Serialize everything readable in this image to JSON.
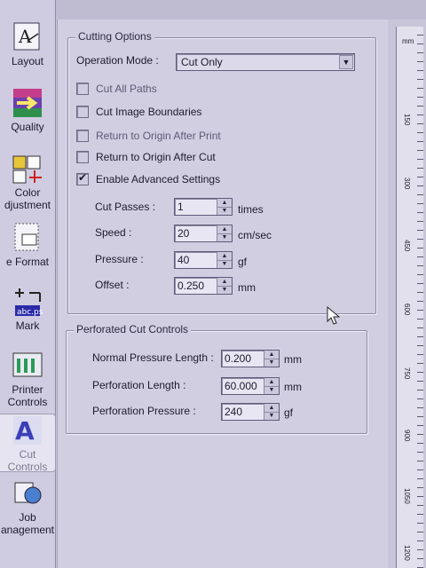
{
  "sidebar": {
    "items": [
      {
        "label": "Layout",
        "icon": "layout-icon"
      },
      {
        "label": "Quality",
        "icon": "quality-icon"
      },
      {
        "label": "Color Adjustment",
        "line1": "Color",
        "line2": "djustment",
        "icon": "color-adjustment-icon"
      },
      {
        "label": "e Format",
        "icon": "page-format-icon"
      },
      {
        "label": "Mark",
        "icon": "mark-icon"
      },
      {
        "label": "Printer Controls",
        "line1": "Printer",
        "line2": "Controls",
        "icon": "printer-controls-icon"
      },
      {
        "label": "Cut Controls",
        "line1": "Cut",
        "line2": "Controls",
        "icon": "cut-controls-icon",
        "selected": true
      },
      {
        "label": "Job Management",
        "line1": "Job",
        "line2": "anagement",
        "icon": "job-management-icon"
      }
    ],
    "icon_label": {
      "abc": "abc.ps",
      "ps": "ps"
    }
  },
  "cutting_options": {
    "title": "Cutting Options",
    "operation_mode_label": "Operation Mode :",
    "operation_mode_value": "Cut Only",
    "checkboxes": [
      {
        "label": "Cut All Paths",
        "checked": false
      },
      {
        "label": "Cut Image Boundaries",
        "checked": false
      },
      {
        "label": "Return to Origin After Print",
        "checked": false
      },
      {
        "label": "Return to Origin After Cut",
        "checked": false
      },
      {
        "label": "Enable Advanced Settings",
        "checked": true
      }
    ],
    "fields": [
      {
        "label": "Cut Passes :",
        "value": "1",
        "unit": "times"
      },
      {
        "label": "Speed :",
        "value": "20",
        "unit": "cm/sec"
      },
      {
        "label": "Pressure :",
        "value": "40",
        "unit": "gf"
      },
      {
        "label": "Offset :",
        "value": "0.250",
        "unit": "mm"
      }
    ]
  },
  "perforated": {
    "title": "Perforated Cut Controls",
    "fields": [
      {
        "label": "Normal Pressure Length :",
        "value": "0.200",
        "unit": "mm"
      },
      {
        "label": "Perforation Length :",
        "value": "60.000",
        "unit": "mm"
      },
      {
        "label": "Perforation Pressure :",
        "value": "240",
        "unit": "gf"
      }
    ]
  },
  "ruler": {
    "unit": "mm",
    "ticks": [
      "150",
      "300",
      "450",
      "600",
      "750",
      "900",
      "1050",
      "1200"
    ]
  },
  "colors": {
    "panel_bg": "#d2cee2",
    "sidebar_bg": "#cfcbe0",
    "selected_accent": "#3a3fb8"
  }
}
